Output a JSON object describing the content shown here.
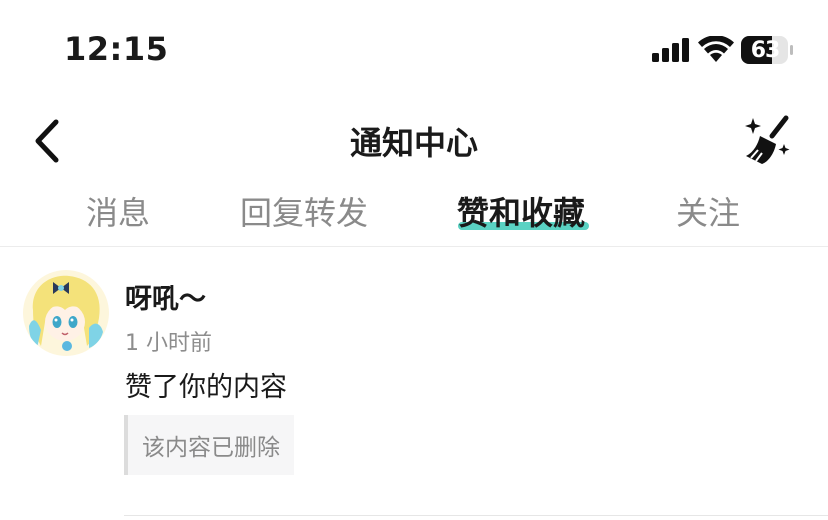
{
  "status_bar": {
    "time": "12:15",
    "battery": "63"
  },
  "header": {
    "title": "通知中心",
    "back_icon": "chevron-left-icon",
    "clear_icon": "broom-sparkle-icon"
  },
  "tabs": [
    {
      "label": "消息",
      "active": false
    },
    {
      "label": "回复转发",
      "active": false
    },
    {
      "label": "赞和收藏",
      "active": true
    },
    {
      "label": "关注",
      "active": false
    }
  ],
  "accent_color": "#5ad2c3",
  "notifications": [
    {
      "username": "呀吼～",
      "time": "1 小时前",
      "action": "赞了你的内容",
      "quoted": "该内容已删除"
    }
  ]
}
